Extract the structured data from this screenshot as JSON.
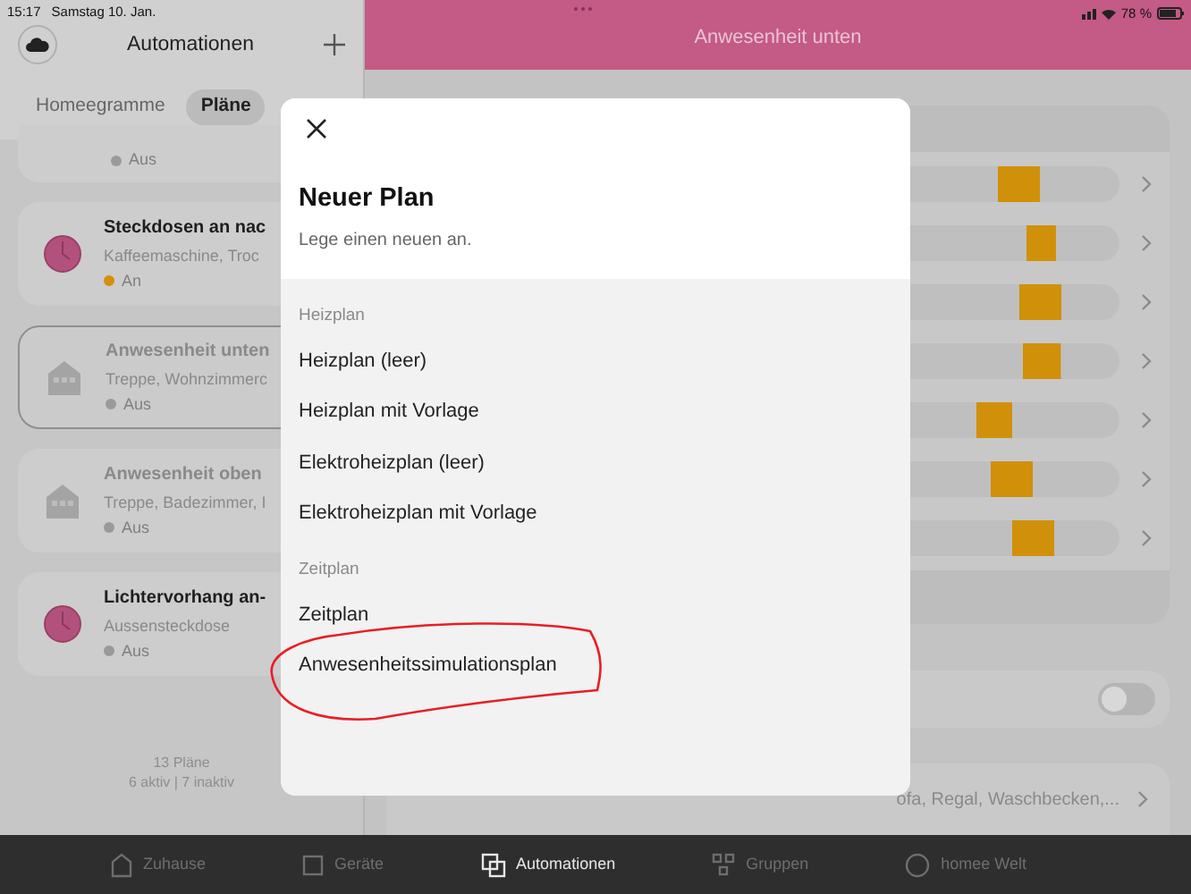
{
  "status_bar": {
    "time": "15:17",
    "date": "Samstag 10. Jan.",
    "battery": "78 %"
  },
  "sidebar": {
    "title": "Automationen",
    "tabs": [
      {
        "label": "Homeegramme",
        "selected": false
      },
      {
        "label": "Pläne",
        "selected": true
      }
    ],
    "plans": [
      {
        "kind": "partial",
        "status": "Aus",
        "active": false,
        "selected": false
      },
      {
        "kind": "timer",
        "title": "Steckdosen an nac",
        "devices": "Kaffeemaschine, Troc",
        "status": "An",
        "active": true,
        "selected": false
      },
      {
        "kind": "presence",
        "title": "Anwesenheit unten",
        "devices": "Treppe, Wohnzimmerc",
        "status": "Aus",
        "active": false,
        "selected": true
      },
      {
        "kind": "presence",
        "title": "Anwesenheit oben",
        "devices": "Treppe, Badezimmer, I",
        "status": "Aus",
        "active": false,
        "selected": false
      },
      {
        "kind": "timer",
        "title": "Lichtervorhang an-",
        "devices": "Aussensteckdose",
        "status": "Aus",
        "active": false,
        "selected": false
      }
    ],
    "footer": [
      "13 Pläne",
      "6 aktiv | 7 inaktiv"
    ]
  },
  "detail": {
    "title": "Anwesenheit unten",
    "toggle": {
      "on": false
    },
    "devices_value": "ofa, Regal, Waschbecken,..."
  },
  "dialog": {
    "title": "Neuer Plan",
    "subtitle": "Lege einen neuen an.",
    "sections": [
      {
        "heading": "Heizplan",
        "items": [
          "Heizplan (leer)",
          "Heizplan mit Vorlage",
          "Elektroheizplan (leer)",
          "Elektroheizplan mit Vorlage"
        ]
      },
      {
        "heading": "Zeitplan",
        "items": [
          "Zeitplan",
          "Anwesenheitssimulationsplan"
        ]
      }
    ]
  },
  "tab_bar": [
    {
      "kind": "home",
      "label": "Zuhause",
      "selected": false
    },
    {
      "kind": "devices",
      "label": "Geräte",
      "selected": false
    },
    {
      "kind": "automations",
      "label": "Automationen",
      "selected": true
    },
    {
      "kind": "groups",
      "label": "Gruppen",
      "selected": false
    },
    {
      "kind": "world",
      "label": "homee Welt",
      "selected": false
    }
  ]
}
